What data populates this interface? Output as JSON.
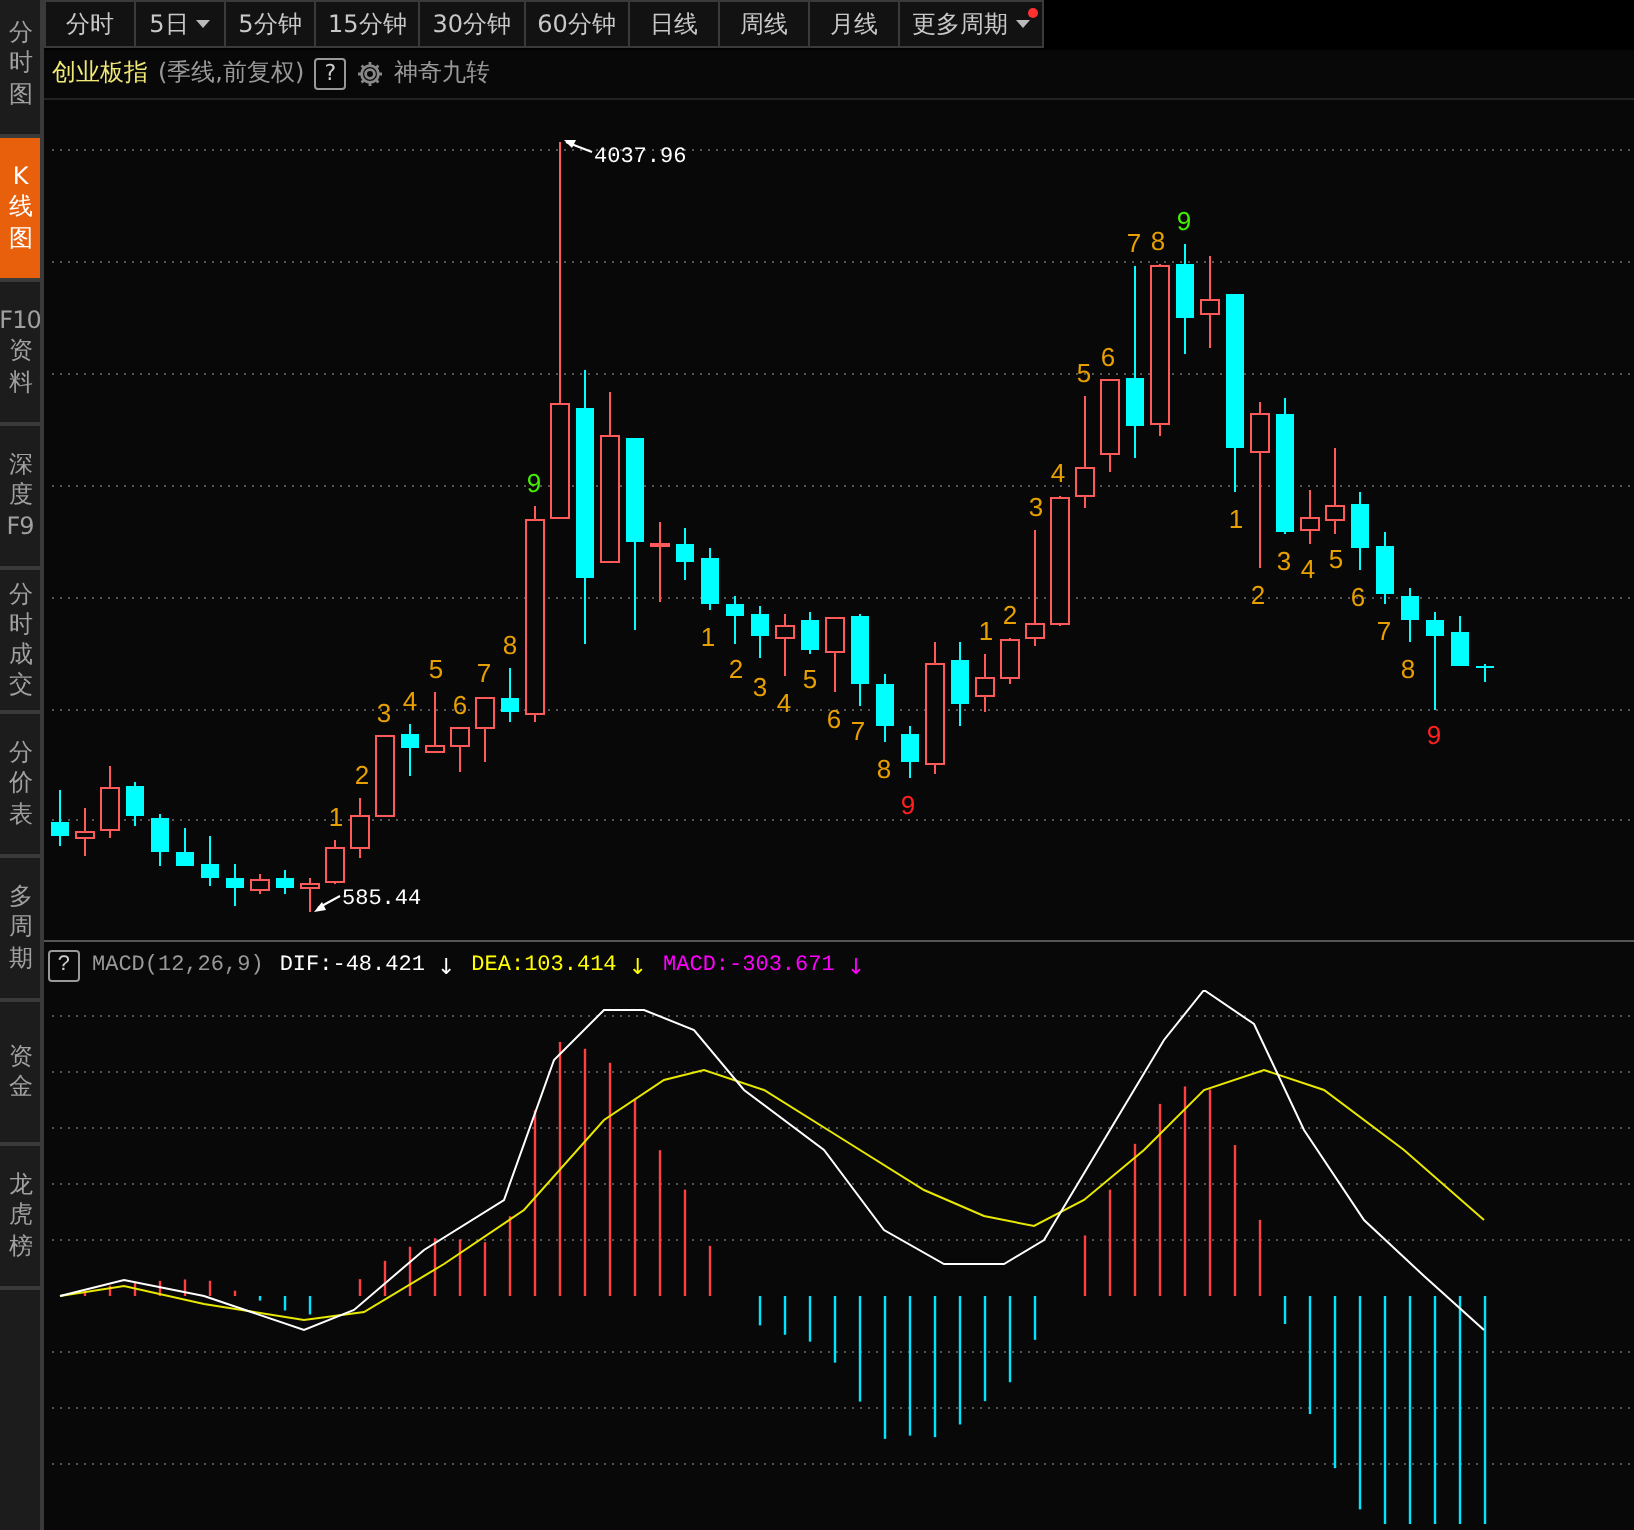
{
  "sidebar": {
    "items": [
      {
        "label": "分时图",
        "selected": false
      },
      {
        "label": "K线图",
        "selected": true
      },
      {
        "label": "F10资料",
        "selected": false
      },
      {
        "label": "深度F9",
        "selected": false
      },
      {
        "label": "分时成交",
        "selected": false
      },
      {
        "label": "分价表",
        "selected": false
      },
      {
        "label": "多周期",
        "selected": false
      },
      {
        "label": "资金",
        "selected": false
      },
      {
        "label": "龙虎榜",
        "selected": false
      }
    ]
  },
  "period_tabs": [
    {
      "label": "分时",
      "selected": false,
      "dropdown": false,
      "notification": false
    },
    {
      "label": "5日",
      "selected": false,
      "dropdown": true,
      "notification": false
    },
    {
      "label": "5分钟",
      "selected": false,
      "dropdown": false,
      "notification": false
    },
    {
      "label": "15分钟",
      "selected": false,
      "dropdown": false,
      "notification": false
    },
    {
      "label": "30分钟",
      "selected": false,
      "dropdown": false,
      "notification": false
    },
    {
      "label": "60分钟",
      "selected": false,
      "dropdown": false,
      "notification": false
    },
    {
      "label": "日线",
      "selected": false,
      "dropdown": false,
      "notification": false
    },
    {
      "label": "周线",
      "selected": false,
      "dropdown": false,
      "notification": false
    },
    {
      "label": "月线",
      "selected": false,
      "dropdown": false,
      "notification": false
    },
    {
      "label": "更多周期",
      "selected": false,
      "dropdown": true,
      "notification": true
    }
  ],
  "index_bar": {
    "name": "创业板指",
    "period_info": "(季线,前复权)",
    "help": "?",
    "indicator": "神奇九转"
  },
  "chart": {
    "high_label": "4037.96",
    "low_label": "585.44",
    "td_counts": [
      {
        "text": "1",
        "color": "#e8a000"
      },
      {
        "text": "2",
        "color": "#e8a000"
      },
      {
        "text": "3",
        "color": "#e8a000"
      },
      {
        "text": "4",
        "color": "#e8a000"
      },
      {
        "text": "5",
        "color": "#e8a000"
      },
      {
        "text": "6",
        "color": "#e8a000"
      },
      {
        "text": "7",
        "color": "#e8a000"
      },
      {
        "text": "8",
        "color": "#e8a000"
      },
      {
        "text": "9",
        "color": "#44ee00"
      },
      {
        "text": "1",
        "color": "#e8a000"
      },
      {
        "text": "2",
        "color": "#e8a000"
      },
      {
        "text": "3",
        "color": "#e8a000"
      },
      {
        "text": "4",
        "color": "#e8a000"
      },
      {
        "text": "5",
        "color": "#e8a000"
      },
      {
        "text": "6",
        "color": "#e8a000"
      },
      {
        "text": "7",
        "color": "#e8a000"
      },
      {
        "text": "8",
        "color": "#e8a000"
      },
      {
        "text": "9",
        "color": "#ff2020"
      },
      {
        "text": "1",
        "color": "#e8a000"
      },
      {
        "text": "2",
        "color": "#e8a000"
      },
      {
        "text": "3",
        "color": "#e8a000"
      },
      {
        "text": "4",
        "color": "#e8a000"
      },
      {
        "text": "5",
        "color": "#e8a000"
      },
      {
        "text": "6",
        "color": "#e8a000"
      },
      {
        "text": "7",
        "color": "#e8a000"
      },
      {
        "text": "8",
        "color": "#e8a000"
      },
      {
        "text": "9",
        "color": "#44ee00"
      },
      {
        "text": "1",
        "color": "#e8a000"
      },
      {
        "text": "2",
        "color": "#e8a000"
      },
      {
        "text": "3",
        "color": "#e8a000"
      },
      {
        "text": "4",
        "color": "#e8a000"
      },
      {
        "text": "5",
        "color": "#e8a000"
      },
      {
        "text": "6",
        "color": "#e8a000"
      },
      {
        "text": "7",
        "color": "#e8a000"
      },
      {
        "text": "8",
        "color": "#e8a000"
      },
      {
        "text": "9",
        "color": "#ff2020"
      }
    ]
  },
  "macd": {
    "help": "?",
    "name": "MACD(12,26,9)",
    "readings": [
      {
        "label": "DIF:-48.421",
        "arrow": "↓",
        "color": "#ffffff"
      },
      {
        "label": "DEA:103.414",
        "arrow": "↓",
        "color": "#ffff00"
      },
      {
        "label": "MACD:-303.671",
        "arrow": "↓",
        "color": "#ff00ff"
      }
    ]
  }
}
